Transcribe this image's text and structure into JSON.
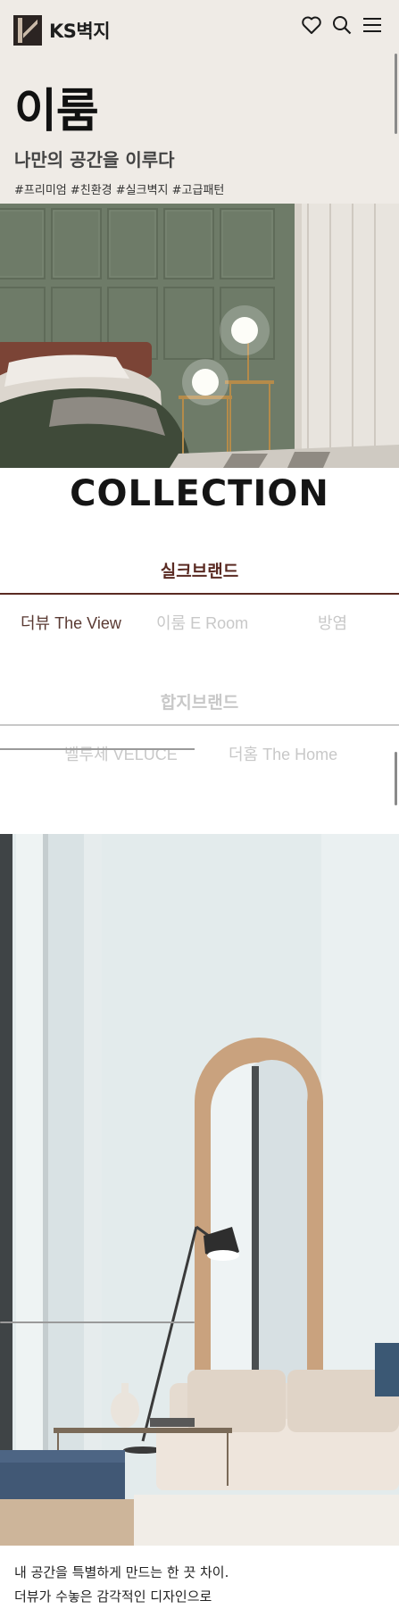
{
  "header": {
    "logo_text": "KS벽지",
    "icons": [
      "heart-icon",
      "search-icon",
      "menu-icon"
    ]
  },
  "hero": {
    "title": "이룸",
    "subtitle": "나만의 공간을 이루다",
    "tags": "#프리미엄 #친환경 #실크벽지 #고급패턴"
  },
  "collection": {
    "title": "COLLECTION",
    "groups": [
      {
        "label": "실크브랜드",
        "active": true,
        "items": [
          {
            "label": "더뷰 The View",
            "active": true
          },
          {
            "label": "이룸 E Room",
            "active": false
          },
          {
            "label": "방염",
            "active": false
          }
        ]
      },
      {
        "label": "합지브랜드",
        "active": false,
        "items": [
          {
            "label": "벨루체 VELUCE",
            "active": false
          },
          {
            "label": "더홈 The Home",
            "active": false
          }
        ]
      }
    ]
  },
  "description": {
    "line1": "내 공간을 특별하게 만드는 한 끗 차이.",
    "line2": "더뷰가 수놓은 감각적인 디자인으로"
  },
  "colors": {
    "accent": "#5a2a22",
    "hero_bg": "#efebe6",
    "inactive": "#c8c8c8"
  }
}
